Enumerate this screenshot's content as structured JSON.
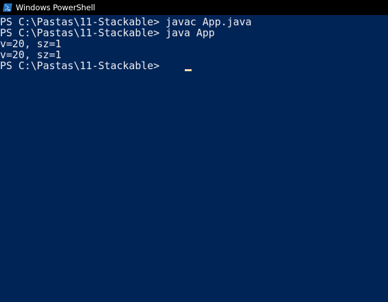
{
  "window": {
    "title": "Windows PowerShell",
    "icon": "powershell-icon"
  },
  "colors": {
    "background": "#012456",
    "text": "#eeedf0",
    "cursor": "#fedba9",
    "titlebar": "#000000"
  },
  "console": {
    "lines": [
      "PS C:\\Pastas\\11-Stackable> javac App.java",
      "PS C:\\Pastas\\11-Stackable> java App",
      "v=20, sz=1",
      "v=20, sz=1",
      "PS C:\\Pastas\\11-Stackable> "
    ]
  }
}
